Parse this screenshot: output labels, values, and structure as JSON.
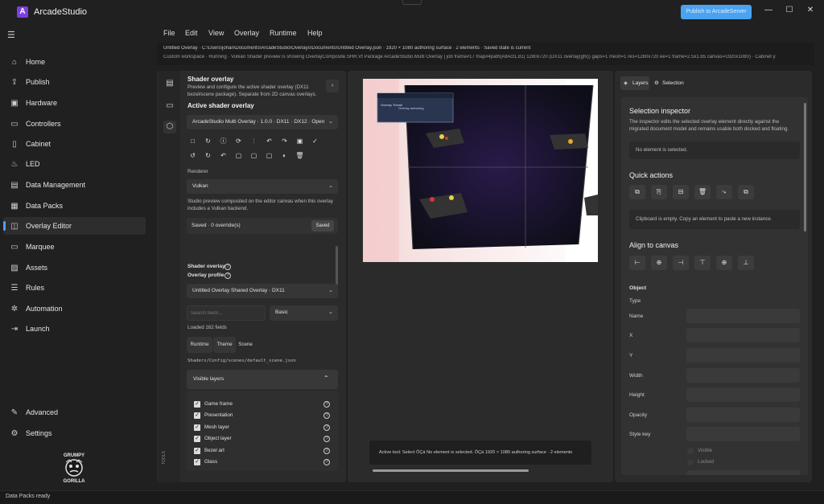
{
  "app": {
    "title": "ArcadeStudio",
    "logo_glyph": "A",
    "publish_label": "Publish to ArcadeServer",
    "accent": "#4aa3f0",
    "brand": "#7b3fe0"
  },
  "window": {
    "minimize": "—",
    "maximize": "☐",
    "close": "✕"
  },
  "sidebar": {
    "items": [
      {
        "label": "Home",
        "icon": "home-icon",
        "glyph": "⌂"
      },
      {
        "label": "Publish",
        "icon": "publish-icon",
        "glyph": "⇪"
      },
      {
        "label": "Hardware",
        "icon": "hardware-icon",
        "glyph": "▣"
      },
      {
        "label": "Controllers",
        "icon": "controllers-icon",
        "glyph": "▭"
      },
      {
        "label": "Cabinet",
        "icon": "cabinet-icon",
        "glyph": "▯"
      },
      {
        "label": "LED",
        "icon": "led-icon",
        "glyph": "♨"
      },
      {
        "label": "Data Management",
        "icon": "data-management-icon",
        "glyph": "▤"
      },
      {
        "label": "Data Packs",
        "icon": "data-packs-icon",
        "glyph": "▦"
      },
      {
        "label": "Overlay Editor",
        "icon": "overlay-editor-icon",
        "glyph": "◫",
        "active": true
      },
      {
        "label": "Marquee",
        "icon": "marquee-icon",
        "glyph": "▭"
      },
      {
        "label": "Assets",
        "icon": "assets-icon",
        "glyph": "▨"
      },
      {
        "label": "Rules",
        "icon": "rules-icon",
        "glyph": "☰"
      },
      {
        "label": "Automation",
        "icon": "automation-icon",
        "glyph": "✲"
      },
      {
        "label": "Launch",
        "icon": "launch-icon",
        "glyph": "⇥"
      }
    ],
    "bottom": [
      {
        "label": "Advanced",
        "icon": "wrench-icon",
        "glyph": "✎"
      },
      {
        "label": "Settings",
        "icon": "gear-icon",
        "glyph": "⚙"
      }
    ],
    "logo_top": "GRUMPY",
    "logo_bottom": "GORILLA"
  },
  "menubar": [
    "File",
    "Edit",
    "View",
    "Overlay",
    "Runtime",
    "Help"
  ],
  "info": {
    "line1": "Untitled Overlay · C:\\Users\\johan\\Documents\\ArcadeStudio\\Overlays\\Documents\\Untitled Overlay.json · 1920 × 1080 authoring surface · 2 elements · Saved state is current",
    "line2": "Custom workspace · Running · Vulkan Shader preview is showing OverlayComposite.SHR.Vt Package ArcadeStudio.Multi Overlay | job frame#17 map#4path(AllAct1,81) 1280x720 (DX11 overlay(gfx)) gaps=1 mesh=1 res=1280x720 ee=1 frame=2.5x1.65 canvas=1920x1080) · Cabinet y"
  },
  "shader": {
    "title": "Shader overlay",
    "desc1": "Preview and configure the active shader overlay (DX11",
    "desc2": "bezel/scene package). Separate from 2D canvas overlays.",
    "more": "›",
    "active_label": "Active shader overlay",
    "active_value": "ArcadeStudio Multi Overlay · 1.0.0 · DX11 · DX12 · Open",
    "tools_row1": [
      "□",
      "↻",
      "ⓘ",
      "⟳",
      "⫶",
      "↶",
      "↷",
      "▣",
      "✓"
    ],
    "tools_row2": [
      "↺",
      "↻",
      "↶",
      "▢",
      "▢",
      "▢",
      "◐",
      "🗑"
    ],
    "renderer_label": "Renderer",
    "renderer_value": "Vulkan",
    "renderer_note1": "Studio preview composited on the editor canvas when this overlay",
    "renderer_note2": "includes a Vulkan backend.",
    "saved_text": "Saved · 0 override(s)",
    "saved_badge": "Saved",
    "sub_title": "Shader overlay",
    "profile_label": "Overlay profile",
    "profile_value": "Untitled Overlay Shared Overlay · DX11",
    "search_placeholder": "Search fields...",
    "mode_value": "Basic",
    "loaded": "Loaded 162 fields",
    "tabs": [
      "Runtime",
      "Theme",
      "Scene"
    ],
    "path": "Shaders/Config/scenes/default_scene.json",
    "layers_title": "Visible layers",
    "layers": [
      "Game frame",
      "Presentation",
      "Mesh layer",
      "Object layer",
      "Bezel art",
      "Glass"
    ],
    "rail_label": "TOOLS"
  },
  "preview": {
    "mini_title": "Overlay Theme",
    "mini_sub": "Overlay authoring",
    "status_text": "Active tool: Select   ÔÇá   No element is selected.   ÔÇá   1920 × 1080 authoring surface · 2 elements"
  },
  "inspector": {
    "tab_layers": "Layers",
    "tab_selection": "Selection",
    "title": "Selection inspector",
    "desc1": "The inspector edits the selected overlay element directly against the",
    "desc2": "migrated document model and remains usable both docked and floating.",
    "no_selection": "No element is selected.",
    "quick_actions": "Quick actions",
    "qa_glyphs": [
      "⧉",
      "⎘",
      "⊟",
      "🗑",
      "⤷",
      "⧉"
    ],
    "clipboard_note": "Clipboard is empty. Copy an element to paste a new instance.",
    "align_title": "Align to canvas",
    "align_glyphs": [
      "⊢",
      "⊕",
      "⊣",
      "⊤",
      "⊕",
      "⊥"
    ],
    "object_title": "Object",
    "rows": [
      "Type",
      "Name",
      "X",
      "Y",
      "Width",
      "Height",
      "Opacity",
      "Style key"
    ],
    "visible": "Visible",
    "locked": "Locked"
  },
  "statusbar": {
    "text": "Data Packs ready"
  }
}
